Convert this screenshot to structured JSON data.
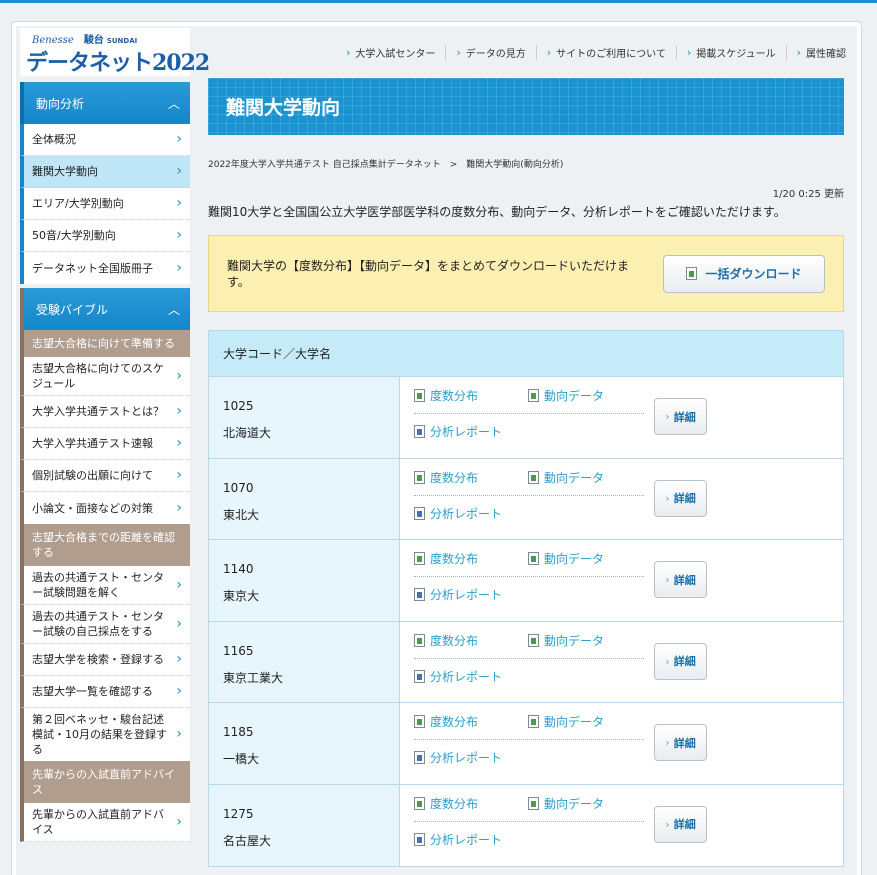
{
  "logo": {
    "brand": "Benesse",
    "sundai": "駿台",
    "sundai_en": "SUNDAI",
    "title": "データネット2022"
  },
  "topnav": [
    {
      "label": "大学入試センター"
    },
    {
      "label": "データの見方"
    },
    {
      "label": "サイトのご利用について"
    },
    {
      "label": "掲載スケジュール"
    },
    {
      "label": "属性確認"
    }
  ],
  "sidebar": {
    "section1": {
      "title": "動向分析",
      "items": [
        {
          "label": "全体概況"
        },
        {
          "label": "難関大学動向"
        },
        {
          "label": "エリア/大学別動向"
        },
        {
          "label": "50音/大学別動向"
        },
        {
          "label": "データネット全国版冊子"
        }
      ]
    },
    "section2": {
      "title": "受験バイブル",
      "cat1": "志望大合格に向けて準備する",
      "cat1_items": [
        {
          "label": "志望大合格に向けてのスケジュール"
        },
        {
          "label": "大学入学共通テストとは？"
        },
        {
          "label": "大学入学共通テスト速報"
        },
        {
          "label": "個別試験の出願に向けて"
        },
        {
          "label": "小論文・面接などの対策"
        }
      ],
      "cat2": "志望大合格までの距離を確認する",
      "cat2_items": [
        {
          "label": "過去の共通テスト・センター試験問題を解く"
        },
        {
          "label": "過去の共通テスト・センター試験の自己採点をする"
        },
        {
          "label": "志望大学を検索・登録する"
        },
        {
          "label": "志望大学一覧を確認する"
        },
        {
          "label": "第２回ベネッセ・駿台記述模試・10月の結果を登録する"
        }
      ],
      "cat3": "先輩からの入試直前アドバイス",
      "cat3_items": [
        {
          "label": "先輩からの入試直前アドバイス"
        }
      ]
    }
  },
  "main": {
    "banner_title": "難関大学動向",
    "breadcrumb": "2022年度大学入学共通テスト 自己採点集計データネット　>　難関大学動向(動向分析)",
    "updated": "1/20 0:25 更新",
    "intro": "難関10大学と全国国公立大学医学部医学科の度数分布、動向データ、分析レポートをご確認いただけます。",
    "notice": "難関大学の【度数分布】【動向データ】をまとめてダウンロードいただけます。",
    "download_label": "一括ダウンロード",
    "table_header": "大学コード／大学名",
    "link_labels": {
      "dist": "度数分布",
      "trend": "動向データ",
      "report": "分析レポート"
    },
    "detail_label": "詳細",
    "rows": [
      {
        "code": "1025",
        "name": "北海道大"
      },
      {
        "code": "1070",
        "name": "東北大"
      },
      {
        "code": "1140",
        "name": "東京大"
      },
      {
        "code": "1165",
        "name": "東京工業大"
      },
      {
        "code": "1185",
        "name": "一橋大"
      },
      {
        "code": "1275",
        "name": "名古屋大"
      }
    ]
  },
  "colors": {
    "accent": "#1b8fd0",
    "banner": "#1a93d1",
    "notice_bg": "#fbf0b2",
    "category_bg": "#b09d8e",
    "table_header_bg": "#c6ebf8",
    "link": "#2aa0cc"
  },
  "icons": {
    "nav_chevron": "chevron-right-icon",
    "collapse": "chevron-up-icon",
    "excel": "excel-file-icon",
    "pdf": "pdf-file-icon"
  }
}
